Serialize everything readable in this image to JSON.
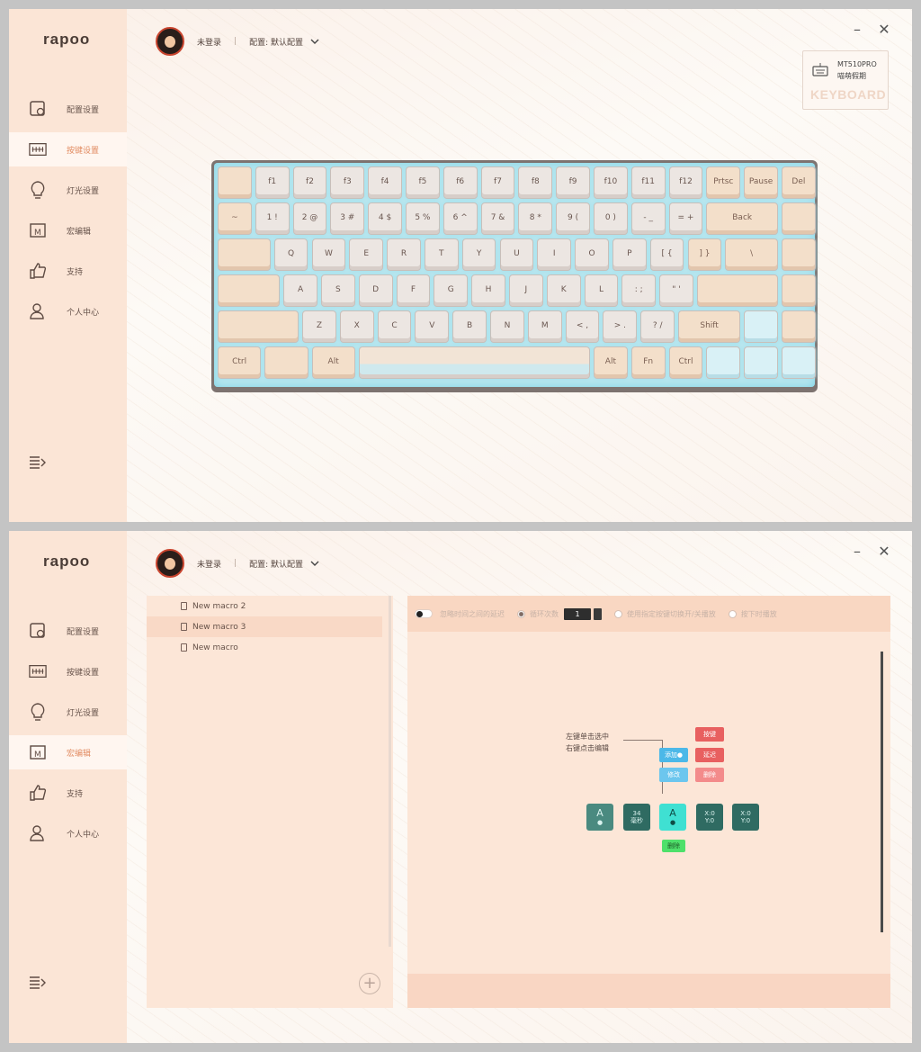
{
  "brand": "rapoo",
  "user": {
    "name": "未登录",
    "config_label": "配置: 默认配置"
  },
  "nav": [
    {
      "id": "config",
      "label": "配置设置",
      "icon": "config-icon"
    },
    {
      "id": "keys",
      "label": "按键设置",
      "icon": "keyboard-icon"
    },
    {
      "id": "light",
      "label": "灯光设置",
      "icon": "bulb-icon"
    },
    {
      "id": "macro",
      "label": "宏编辑",
      "icon": "macro-icon"
    },
    {
      "id": "support",
      "label": "支持",
      "icon": "thumbs-up-icon"
    },
    {
      "id": "profile",
      "label": "个人中心",
      "icon": "user-icon"
    }
  ],
  "window1": {
    "active_nav": "keys"
  },
  "window2": {
    "active_nav": "macro"
  },
  "device": {
    "model": "MT510PRO",
    "theme": "喵萌假期",
    "label": "KEYBOARD"
  },
  "keyboard": {
    "rows": [
      [
        "",
        "f1",
        "f2",
        "f3",
        "f4",
        "f5",
        "f6",
        "f7",
        "f8",
        "f9",
        "f10",
        "f11",
        "f12",
        "Prtsc",
        "Pause",
        "Del"
      ],
      [
        "~",
        "1 !",
        "2 @",
        "3 #",
        "4 $",
        "5 %",
        "6 ^",
        "7 &",
        "8 *",
        "9 (",
        "0 )",
        "- _",
        "= +",
        "Back",
        ""
      ],
      [
        "",
        "Q",
        "W",
        "E",
        "R",
        "T",
        "Y",
        "U",
        "I",
        "O",
        "P",
        "[ {",
        "] }",
        "\\",
        ""
      ],
      [
        "",
        "A",
        "S",
        "D",
        "F",
        "G",
        "H",
        "J",
        "K",
        "L",
        ": ;",
        "\" '",
        "",
        ""
      ],
      [
        "",
        "Z",
        "X",
        "C",
        "V",
        "B",
        "N",
        "M",
        "< ,",
        "> .",
        "? /",
        "Shift",
        "",
        ""
      ],
      [
        "Ctrl",
        "",
        "Alt",
        "",
        "Alt",
        "Fn",
        "Ctrl",
        "",
        "",
        ""
      ]
    ]
  },
  "macro_list": [
    {
      "name": "New macro 2",
      "selected": false
    },
    {
      "name": "New macro 3",
      "selected": true
    },
    {
      "name": "New macro",
      "selected": false
    }
  ],
  "toolbar": {
    "toggle_label": "忽略时间之间的延迟",
    "loop_label": "循环次数",
    "loop_count": "1",
    "option2": "使用指定按键切换开/关播放",
    "option3": "按下时播放"
  },
  "editor": {
    "help_line1": "左键单击选中",
    "help_line2": "右键点击编辑",
    "buttons": {
      "add": "添加●",
      "modify": "修改",
      "key": "按键",
      "delay": "延迟",
      "delete": "删除",
      "move": "删除"
    },
    "keys": [
      {
        "top": "A",
        "bottom": "●"
      },
      {
        "top": "34",
        "bottom": "毫秒"
      },
      {
        "top": "A",
        "bottom": "●"
      },
      {
        "top": "X:0",
        "bottom": "Y:0"
      },
      {
        "top": "X:0",
        "bottom": "Y:0"
      }
    ]
  },
  "colors": {
    "accent": "#e28c62",
    "sidebar": "#fbe5d6",
    "panel": "#fce6d7",
    "red": "#e85a5a",
    "blue": "#4cb8e8",
    "green": "#4ee06a",
    "teal": "#2f6b62"
  }
}
